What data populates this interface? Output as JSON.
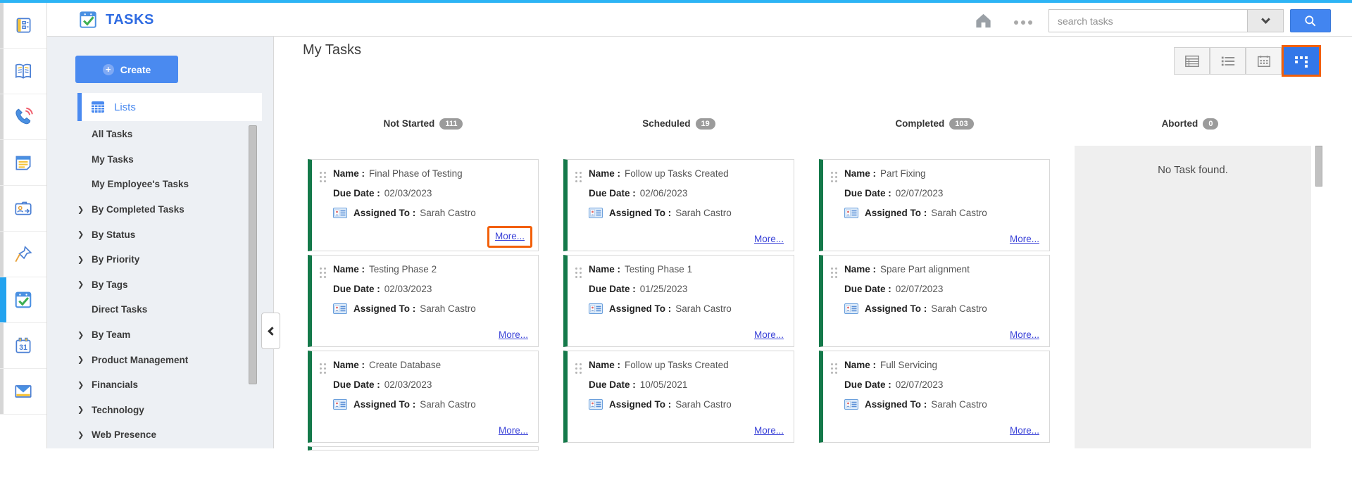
{
  "topbar": {
    "app_title": "TASKS",
    "search": {
      "placeholder": "search tasks"
    }
  },
  "rail": {
    "icons": [
      "newsfeed-icon",
      "knowledge-book-icon",
      "phone-icon",
      "notes-icon",
      "contacts-folder-icon",
      "pin-icon",
      "tasks-icon",
      "calendar-icon",
      "mail-icon"
    ],
    "active_icon": "tasks-icon"
  },
  "sidebar": {
    "create_label": "Create",
    "lists_label": "Lists",
    "items": [
      {
        "label": "All Tasks",
        "expandable": false
      },
      {
        "label": "My Tasks",
        "expandable": false
      },
      {
        "label": "My Employee's Tasks",
        "expandable": false
      },
      {
        "label": "By Completed Tasks",
        "expandable": true
      },
      {
        "label": "By Status",
        "expandable": true
      },
      {
        "label": "By Priority",
        "expandable": true
      },
      {
        "label": "By Tags",
        "expandable": true
      },
      {
        "label": "Direct Tasks",
        "expandable": false
      },
      {
        "label": "By Team",
        "expandable": true
      },
      {
        "label": "Product Management",
        "expandable": true
      },
      {
        "label": "Financials",
        "expandable": true
      },
      {
        "label": "Technology",
        "expandable": true
      },
      {
        "label": "Web Presence",
        "expandable": true
      }
    ]
  },
  "main": {
    "title": "My Tasks",
    "view_buttons": [
      "table-view",
      "list-view",
      "calendar-view",
      "kanban-view"
    ],
    "active_view": "kanban-view"
  },
  "board": {
    "field_labels": {
      "name": "Name :",
      "due_date": "Due Date :",
      "assigned_to": "Assigned To :"
    },
    "more_label": "More...",
    "columns": [
      {
        "label": "Not Started",
        "count": "111",
        "cards": [
          {
            "name": "Final Phase of Testing",
            "due_date": "02/03/2023",
            "assigned_to": "Sarah Castro",
            "highlight_more": true
          },
          {
            "name": "Testing Phase 2",
            "due_date": "02/03/2023",
            "assigned_to": "Sarah Castro",
            "highlight_more": false
          },
          {
            "name": "Create Database",
            "due_date": "02/03/2023",
            "assigned_to": "Sarah Castro",
            "highlight_more": false
          }
        ]
      },
      {
        "label": "Scheduled",
        "count": "19",
        "cards": [
          {
            "name": "Follow up Tasks Created",
            "due_date": "02/06/2023",
            "assigned_to": "Sarah Castro",
            "highlight_more": false
          },
          {
            "name": "Testing Phase 1",
            "due_date": "01/25/2023",
            "assigned_to": "Sarah Castro",
            "highlight_more": false
          },
          {
            "name": "Follow up Tasks Created",
            "due_date": "10/05/2021",
            "assigned_to": "Sarah Castro",
            "highlight_more": false
          }
        ]
      },
      {
        "label": "Completed",
        "count": "103",
        "cards": [
          {
            "name": "Part Fixing",
            "due_date": "02/07/2023",
            "assigned_to": "Sarah Castro",
            "highlight_more": false
          },
          {
            "name": "Spare Part alignment",
            "due_date": "02/07/2023",
            "assigned_to": "Sarah Castro",
            "highlight_more": false
          },
          {
            "name": "Full Servicing",
            "due_date": "02/07/2023",
            "assigned_to": "Sarah Castro",
            "highlight_more": false
          }
        ]
      },
      {
        "label": "Aborted",
        "count": "0",
        "cards": [],
        "empty_text": "No Task found."
      }
    ]
  },
  "colors": {
    "top_strip": "#2db4f5",
    "brand_blue": "#2e6be2",
    "button_blue": "#4a8af0",
    "active_view_blue": "#3377e8",
    "highlight_orange": "#f2600a",
    "card_edge_green": "#14794a",
    "link_blue": "#3b43d8",
    "badge_gray": "#9b9b9b",
    "sidebar_bg": "#edf0f4"
  }
}
